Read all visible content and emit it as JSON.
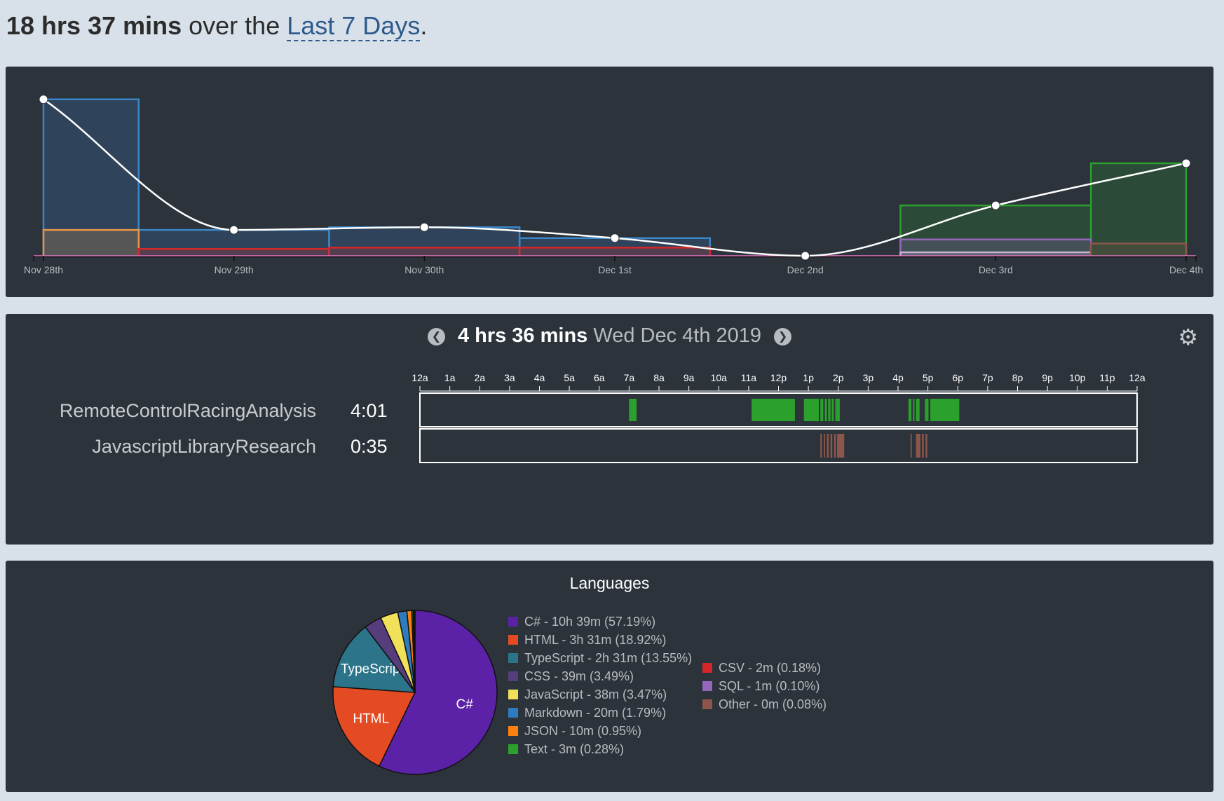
{
  "headline": {
    "total": "18 hrs 37 mins",
    "middle": " over the ",
    "range_link": "Last 7 Days",
    "end": "."
  },
  "weekly_chart": {
    "chart_data": {
      "type": "area",
      "categories": [
        "Nov 28th",
        "Nov 29th",
        "Nov 30th",
        "Dec 1st",
        "Dec 2nd",
        "Dec 3rd",
        "Dec 4th"
      ],
      "series": [
        {
          "kind": "total_line",
          "color": "#ffffff",
          "values": [
            5.75,
            0.95,
            1.05,
            0.65,
            0,
            1.85,
            3.4
          ]
        },
        {
          "kind": "step",
          "color": "#3a86c8",
          "values": [
            5.75,
            0.95,
            1.05,
            0.65,
            0,
            0,
            0
          ]
        },
        {
          "kind": "step",
          "color": "#e8954a",
          "values": [
            0.95,
            0,
            0,
            0,
            0,
            0,
            0
          ]
        },
        {
          "kind": "step",
          "color": "#d62728",
          "values": [
            0,
            0.25,
            0.3,
            0.3,
            0,
            0,
            0
          ]
        },
        {
          "kind": "step",
          "color": "#2ca02c",
          "values": [
            0,
            0,
            0,
            0,
            0,
            1.85,
            3.4
          ]
        },
        {
          "kind": "step",
          "color": "#9467bd",
          "values": [
            0,
            0,
            0,
            0,
            0,
            0.6,
            0
          ]
        },
        {
          "kind": "step",
          "color": "#c5b0d5",
          "values": [
            0,
            0,
            0,
            0,
            0,
            0.13,
            0
          ]
        },
        {
          "kind": "step",
          "color": "#8c564b",
          "values": [
            0,
            0,
            0,
            0,
            0,
            0,
            0.45
          ]
        }
      ],
      "ylim": [
        0,
        6
      ]
    }
  },
  "day_panel": {
    "total": "4 hrs 36 mins",
    "date": "Wed Dec 4th 2019",
    "prev_icon": "chevron-left-icon",
    "next_icon": "chevron-right-icon",
    "settings_icon": "gear-icon",
    "hours": [
      "12a",
      "1a",
      "2a",
      "3a",
      "4a",
      "5a",
      "6a",
      "7a",
      "8a",
      "9a",
      "10a",
      "11a",
      "12p",
      "1p",
      "2p",
      "3p",
      "4p",
      "5p",
      "6p",
      "7p",
      "8p",
      "9p",
      "10p",
      "11p",
      "12a"
    ],
    "projects": [
      {
        "name": "RemoteControlRacingAnalysis",
        "time": "4:01",
        "color": "#2ca02c",
        "segments": [
          [
            7.0,
            7.25
          ],
          [
            11.1,
            12.55
          ],
          [
            12.85,
            13.35
          ],
          [
            13.4,
            13.5
          ],
          [
            13.55,
            13.62
          ],
          [
            13.66,
            13.74
          ],
          [
            13.78,
            13.85
          ],
          [
            13.9,
            14.05
          ],
          [
            16.35,
            16.45
          ],
          [
            16.5,
            16.55
          ],
          [
            16.6,
            16.72
          ],
          [
            16.9,
            17.02
          ],
          [
            17.08,
            18.05
          ]
        ]
      },
      {
        "name": "JavascriptLibraryResearch",
        "time": "0:35",
        "color": "#8c564b",
        "segments": [
          [
            13.4,
            13.45
          ],
          [
            13.52,
            13.56
          ],
          [
            13.62,
            13.68
          ],
          [
            13.74,
            13.8
          ],
          [
            13.86,
            13.92
          ],
          [
            13.96,
            14.2
          ],
          [
            16.42,
            16.46
          ],
          [
            16.6,
            16.75
          ],
          [
            16.8,
            16.86
          ],
          [
            16.92,
            16.98
          ]
        ]
      }
    ]
  },
  "languages_panel": {
    "title": "Languages",
    "chart_data": {
      "type": "pie",
      "slices": [
        {
          "name": "C#",
          "label": "C# - 10h 39m (57.19%)",
          "value": 57.19,
          "color": "#5b22a8",
          "show_label": true
        },
        {
          "name": "HTML",
          "label": "HTML - 3h 31m (18.92%)",
          "value": 18.92,
          "color": "#e44b23",
          "show_label": true
        },
        {
          "name": "TypeScript",
          "label": "TypeScript - 2h 31m (13.55%)",
          "value": 13.55,
          "color": "#2b7489",
          "show_label": true
        },
        {
          "name": "CSS",
          "label": "CSS - 39m (3.49%)",
          "value": 3.49,
          "color": "#563d7c",
          "show_label": false
        },
        {
          "name": "JavaScript",
          "label": "JavaScript - 38m (3.47%)",
          "value": 3.47,
          "color": "#f1e05a",
          "show_label": false
        },
        {
          "name": "Markdown",
          "label": "Markdown - 20m (1.79%)",
          "value": 1.79,
          "color": "#2f7bbf",
          "show_label": false
        },
        {
          "name": "JSON",
          "label": "JSON - 10m (0.95%)",
          "value": 0.95,
          "color": "#ff7f0e",
          "show_label": false
        },
        {
          "name": "Text",
          "label": "Text - 3m (0.28%)",
          "value": 0.28,
          "color": "#2ca02c",
          "show_label": false
        },
        {
          "name": "CSV",
          "label": "CSV - 2m (0.18%)",
          "value": 0.18,
          "color": "#d62728",
          "show_label": false
        },
        {
          "name": "SQL",
          "label": "SQL - 1m (0.10%)",
          "value": 0.1,
          "color": "#9467bd",
          "show_label": false
        },
        {
          "name": "Other",
          "label": "Other - 0m (0.08%)",
          "value": 0.08,
          "color": "#8c564b",
          "show_label": false
        }
      ],
      "slice_labels": {
        "C#": "C#",
        "HTML": "HTML",
        "TypeScript": "TypeScrip"
      }
    }
  }
}
